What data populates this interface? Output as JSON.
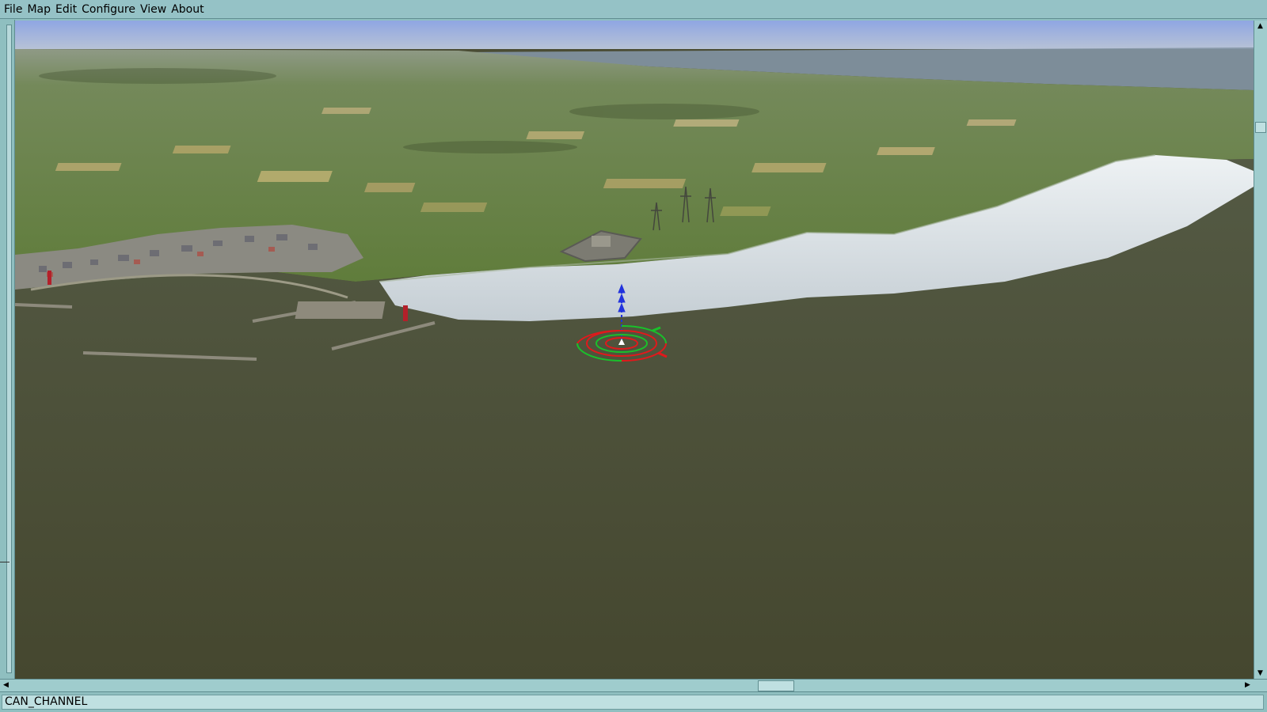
{
  "menu": {
    "items": [
      {
        "label": "File"
      },
      {
        "label": "Map"
      },
      {
        "label": "Edit"
      },
      {
        "label": "Configure"
      },
      {
        "label": "View"
      },
      {
        "label": "About"
      }
    ]
  },
  "viewport": {
    "scene": "3d-terrain-view",
    "colors": {
      "sky": "#8fa6e3",
      "sea": "#4b4d36",
      "fields": "#6e8a44",
      "cliffs": "#dfe6ea",
      "marker_green": "#19c02b",
      "marker_red": "#e0191c",
      "marker_blue": "#2233dd"
    },
    "icons": [
      "selection-rings-icon",
      "altitude-arrows-icon"
    ]
  },
  "status": {
    "map_name": "CAN_CHANNEL"
  },
  "theme": {
    "chrome": "#8fbfc0",
    "border": "#5f8d90"
  }
}
